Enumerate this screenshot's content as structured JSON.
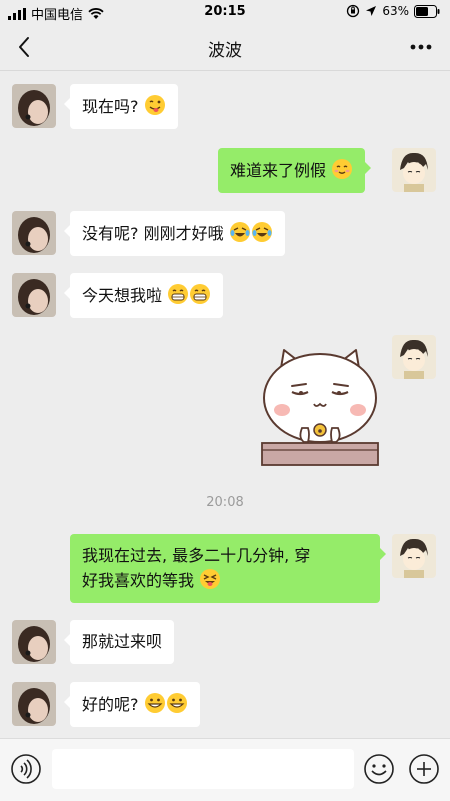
{
  "status_bar": {
    "carrier": "中国电信",
    "time": "20:15",
    "battery_percent": "63%",
    "battery_level": 0.63
  },
  "nav": {
    "title": "波波",
    "back_icon": "chevron-left-icon",
    "more_label": "•••"
  },
  "messages": [
    {
      "sender": "friend",
      "text": "现在吗?",
      "emojis": [
        "wink-tongue"
      ]
    },
    {
      "sender": "me",
      "text": "难道来了例假",
      "emojis": [
        "smile-blush"
      ]
    },
    {
      "sender": "friend",
      "text": "没有呢? 刚刚才好哦",
      "emojis": [
        "rofl",
        "rofl"
      ]
    },
    {
      "sender": "friend",
      "text": "今天想我啦",
      "emojis": [
        "grin",
        "grin"
      ]
    },
    {
      "sender": "me",
      "type": "sticker",
      "sticker": "smug-cat-sticker"
    },
    {
      "sender": "me",
      "text": "我现在过去, 最多二十几分钟, 穿",
      "text_line2": "好我喜欢的等我",
      "emojis": [
        "squint-tongue"
      ]
    },
    {
      "sender": "friend",
      "text": "那就过来呗",
      "emojis": []
    },
    {
      "sender": "friend",
      "text": "好的呢?",
      "emojis": [
        "grin-wide",
        "grin-wide"
      ]
    }
  ],
  "timestamp": "20:08",
  "input_bar": {
    "voice_icon": "voice-icon",
    "emoji_icon": "emoji-icon",
    "plus_icon": "plus-icon",
    "placeholder": ""
  },
  "colors": {
    "background": "#ededed",
    "my_bubble": "#95ec69",
    "friend_bubble": "#ffffff"
  }
}
